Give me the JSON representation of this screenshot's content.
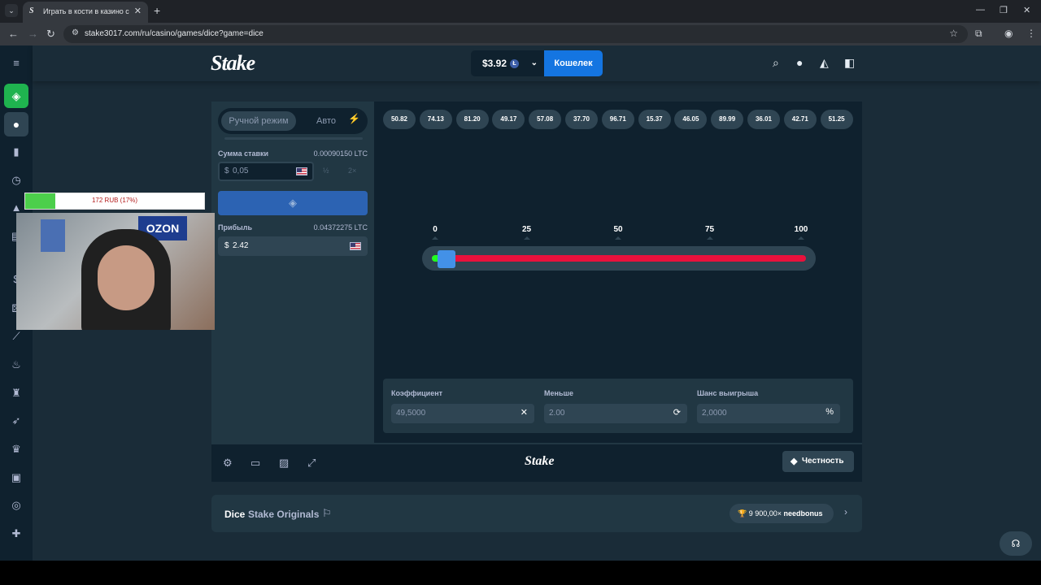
{
  "browser": {
    "tab_title": "Играть в кости в казино с",
    "tab_favicon": "S",
    "url": "stake3017.com/ru/casino/games/dice?game=dice",
    "new_tab": "+",
    "close": "✕"
  },
  "header": {
    "logo": "Stake",
    "balance": "$3.92",
    "currency_badge": "Ł",
    "wallet_label": "Кошелек"
  },
  "controls": {
    "mode_manual": "Ручной режим",
    "mode_auto": "Авто",
    "bet_label": "Сумма ставки",
    "bet_crypto": "0.00090150 LTC",
    "bet_currency": "$",
    "bet_value": "0,05",
    "half_label": "½",
    "double_label": "2×",
    "profit_label": "Прибыль",
    "profit_crypto": "0.04372275 LTC",
    "profit_currency": "$",
    "profit_value": "2.42"
  },
  "results": [
    "50.82",
    "74.13",
    "81.20",
    "49.17",
    "57.08",
    "37.70",
    "96.71",
    "15.37",
    "46.05",
    "89.99",
    "36.01",
    "42.71",
    "51.25"
  ],
  "slider": {
    "scale": [
      "0",
      "25",
      "50",
      "75",
      "100"
    ],
    "value": 2,
    "under_color": "#1fff20",
    "over_color": "#e9113c"
  },
  "stats": {
    "multiplier_label": "Коэффициент",
    "multiplier_value": "49,5000",
    "under_label": "Меньше",
    "under_value": "2.00",
    "chance_label": "Шанс выигрыша",
    "chance_value": "2,0000",
    "chance_suffix": "%"
  },
  "footer": {
    "logo": "Stake",
    "fairness": "Честность"
  },
  "info": {
    "game_name": "Dice",
    "provider": "Stake Originals",
    "record": "9 900,00×",
    "record_user": "needbonus"
  },
  "overlay": {
    "stream_goal": "172 RUB (17%)",
    "goal_percent": 17,
    "webcam_sign": "OZON"
  },
  "colors": {
    "accent": "#1475e1",
    "bg": "#1a2c38",
    "panel": "#213743",
    "dark": "#0f212e",
    "green": "#1fb34f",
    "red": "#e9113c"
  }
}
